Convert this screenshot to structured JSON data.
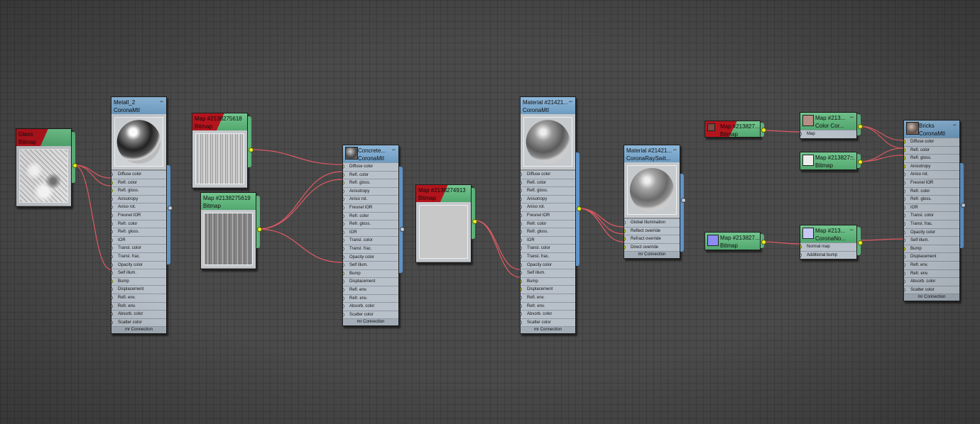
{
  "app": "Slate Material Editor",
  "slot_names": {
    "corona_mtl": [
      "Diffuse color",
      "Refl. color",
      "Refl. gloss.",
      "Anisotropy",
      "Aniso rot.",
      "Fresnel IOR",
      "Refr. color",
      "Refr. gloss.",
      "IOR",
      "Transl. color",
      "Transl. frac.",
      "Opacity color",
      "Self illum.",
      "Bump",
      "Displacement",
      "Refl. env.",
      "Refr. env.",
      "Absorb. color",
      "Scatter color"
    ],
    "corona_ray_switch": [
      "Global illumination",
      "Reflect override",
      "Refract override",
      "Direct override"
    ],
    "corona_normal": [
      "Normal map",
      "Additional bump"
    ],
    "color_correct": [
      "Map"
    ]
  },
  "footer_label": "mr Connection",
  "nodes": {
    "glass_dirt": {
      "line1": "Glass",
      "line2": "Bitmap",
      "icon": "texture-thumbnail",
      "color": "#d8d8d8"
    },
    "metall": {
      "line1": "Metall_2",
      "line2": "CoronaMtl",
      "icon": "chrome-sphere-thumbnail",
      "color": "#1a1a1a"
    },
    "map_5618": {
      "line1": "Map #2138275618",
      "line2": "Bitmap",
      "icon": "wood-grain-thumbnail",
      "color": "#a8a8a8"
    },
    "map_5619": {
      "line1": "Map #2138275619",
      "line2": "Bitmap",
      "icon": "wood-grain-thumbnail",
      "color": "#8e8e8e"
    },
    "concrete": {
      "line1": "Concrete...",
      "line2": "CoronaMtl",
      "icon": "sphere-icon",
      "color": "#555555"
    },
    "map_4913": {
      "line1": "Map #2138274913",
      "line2": "Bitmap",
      "icon": "flat-gray-thumbnail",
      "color": "#c8c8c8"
    },
    "material_a": {
      "line1": "Material #21421...",
      "line2": "CoronaMtl",
      "icon": "glass-sphere-thumbnail",
      "color": "#6e6e6e"
    },
    "material_b": {
      "line1": "Material #21421...",
      "line2": "CoronaRaySwit...",
      "icon": "glass-sphere-thumbnail",
      "color": "#7a7a7a"
    },
    "map_red": {
      "line1": "Map #213827...",
      "line2": "Bitmap",
      "icon": "color-swatch",
      "color": "#7a4a44"
    },
    "map_cc": {
      "line1": "Map #213...",
      "line2": "Color Cor...",
      "icon": "color-swatch",
      "color": "#b88f86"
    },
    "map_white": {
      "line1": "Map #213827...",
      "line2": "Bitmap",
      "icon": "color-swatch",
      "color": "#ececec"
    },
    "map_blue": {
      "line1": "Map #213827...",
      "line2": "Bitmap",
      "icon": "color-swatch",
      "color": "#8c8cf4"
    },
    "map_normal": {
      "line1": "Map #213...",
      "line2": "CoronaNo...",
      "icon": "color-swatch",
      "color": "#c8c8f4"
    },
    "bricks": {
      "line1": "Bricks",
      "line2": "CoronaMtl",
      "icon": "sphere-icon",
      "color": "#6a5850"
    }
  },
  "colors": {
    "wire": "#e05a63",
    "grid_bg": "#4a4a4a",
    "material_header": "#7aa8ce",
    "map_header": "#5fb77e",
    "error_flag": "#b4141c",
    "active_socket": "#e6f02a"
  }
}
